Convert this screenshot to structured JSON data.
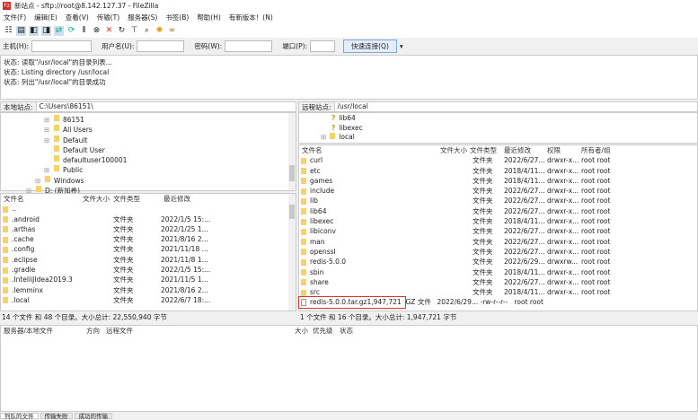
{
  "title": "新站点 - sftp://root@8.142.127.37 - FileZilla",
  "menu": [
    "文件(F)",
    "编辑(E)",
    "查看(V)",
    "传输(T)",
    "服务器(S)",
    "书签(B)",
    "帮助(H)",
    "有新版本！(N)"
  ],
  "quickconnect": {
    "host_label": "主机(H):",
    "user_label": "用户名(U):",
    "pass_label": "密码(W):",
    "port_label": "端口(P):",
    "connect_label": "快速连接(Q)"
  },
  "log": [
    "状态:  读取\"/usr/local\"的目录列表...",
    "状态:  Listing directory /usr/local",
    "状态:  列出\"/usr/local\"的目录成功"
  ],
  "local": {
    "label": "本地站点:",
    "path": "C:\\Users\\86151\\",
    "tree": [
      "86151",
      "All Users",
      "Default",
      "Default User",
      "defaultuser100001",
      "Public",
      "Windows",
      "D: (新加卷)"
    ],
    "headers": [
      "文件名",
      "文件大小",
      "文件类型",
      "最近修改"
    ],
    "files": [
      {
        "name": "..",
        "type": "",
        "date": ""
      },
      {
        "name": ".android",
        "type": "文件夹",
        "date": "2022/1/5 15:..."
      },
      {
        "name": ".arthas",
        "type": "文件夹",
        "date": "2022/1/25 1..."
      },
      {
        "name": ".cache",
        "type": "文件夹",
        "date": "2021/8/16 2..."
      },
      {
        "name": ".config",
        "type": "文件夹",
        "date": "2021/11/18 ..."
      },
      {
        "name": ".eclipse",
        "type": "文件夹",
        "date": "2021/11/8 1..."
      },
      {
        "name": ".gradle",
        "type": "文件夹",
        "date": "2022/1/5 15:..."
      },
      {
        "name": ".IntelliJIdea2019.3",
        "type": "文件夹",
        "date": "2021/11/5 1..."
      },
      {
        "name": ".lemminx",
        "type": "文件夹",
        "date": "2021/8/16 2..."
      },
      {
        "name": ".local",
        "type": "文件夹",
        "date": "2022/6/7 18:..."
      }
    ],
    "status": "14 个文件 和 48 个目录。大小总计: 22,550,940 字节"
  },
  "remote": {
    "label": "远程站点:",
    "path": "/usr/local",
    "tree": [
      "lib64",
      "libexec",
      "local"
    ],
    "headers": [
      "文件名",
      "文件大小",
      "文件类型",
      "最近修改",
      "权限",
      "所有者/组"
    ],
    "files": [
      {
        "name": "curl",
        "size": "",
        "type": "文件夹",
        "date": "2022/6/27...",
        "perm": "drwxr-x...",
        "owner": "root root"
      },
      {
        "name": "etc",
        "size": "",
        "type": "文件夹",
        "date": "2018/4/11...",
        "perm": "drwxr-x...",
        "owner": "root root"
      },
      {
        "name": "games",
        "size": "",
        "type": "文件夹",
        "date": "2018/4/11...",
        "perm": "drwxr-x...",
        "owner": "root root"
      },
      {
        "name": "include",
        "size": "",
        "type": "文件夹",
        "date": "2022/6/27...",
        "perm": "drwxr-x...",
        "owner": "root root"
      },
      {
        "name": "lib",
        "size": "",
        "type": "文件夹",
        "date": "2022/6/27...",
        "perm": "drwxr-x...",
        "owner": "root root"
      },
      {
        "name": "lib64",
        "size": "",
        "type": "文件夹",
        "date": "2022/6/27...",
        "perm": "drwxr-x...",
        "owner": "root root"
      },
      {
        "name": "libexec",
        "size": "",
        "type": "文件夹",
        "date": "2018/4/11...",
        "perm": "drwxr-x...",
        "owner": "root root"
      },
      {
        "name": "libiconv",
        "size": "",
        "type": "文件夹",
        "date": "2022/6/27...",
        "perm": "drwxr-x...",
        "owner": "root root"
      },
      {
        "name": "man",
        "size": "",
        "type": "文件夹",
        "date": "2022/6/27...",
        "perm": "drwxr-x...",
        "owner": "root root"
      },
      {
        "name": "openssl",
        "size": "",
        "type": "文件夹",
        "date": "2022/6/27...",
        "perm": "drwxr-x...",
        "owner": "root root"
      },
      {
        "name": "redis-5.0.0",
        "size": "",
        "type": "文件夹",
        "date": "2022/6/29...",
        "perm": "drwxrw...",
        "owner": "root root"
      },
      {
        "name": "sbin",
        "size": "",
        "type": "文件夹",
        "date": "2018/4/11...",
        "perm": "drwxr-x...",
        "owner": "root root"
      },
      {
        "name": "share",
        "size": "",
        "type": "文件夹",
        "date": "2022/6/27...",
        "perm": "drwxr-x...",
        "owner": "root root"
      },
      {
        "name": "src",
        "size": "",
        "type": "文件夹",
        "date": "2018/4/11...",
        "perm": "drwxr-x...",
        "owner": "root root"
      },
      {
        "name": "redis-5.0.0.tar.gz",
        "size": "1,947,721",
        "type": "GZ 文件",
        "date": "2022/6/29...",
        "perm": "-rw-r--r--",
        "owner": "root root",
        "file": true
      }
    ],
    "status": "1 个文件 和 16 个目录。大小总计: 1,947,721 字节"
  },
  "queue": {
    "headers": [
      "服务器/本地文件",
      "方向",
      "远程文件",
      "大小",
      "优先级",
      "状态"
    ],
    "tabs": [
      "列队的文件",
      "传输失败",
      "成功的传输"
    ]
  },
  "colors": {
    "highlight": "#d9342b",
    "folder": "#f5d36b"
  }
}
